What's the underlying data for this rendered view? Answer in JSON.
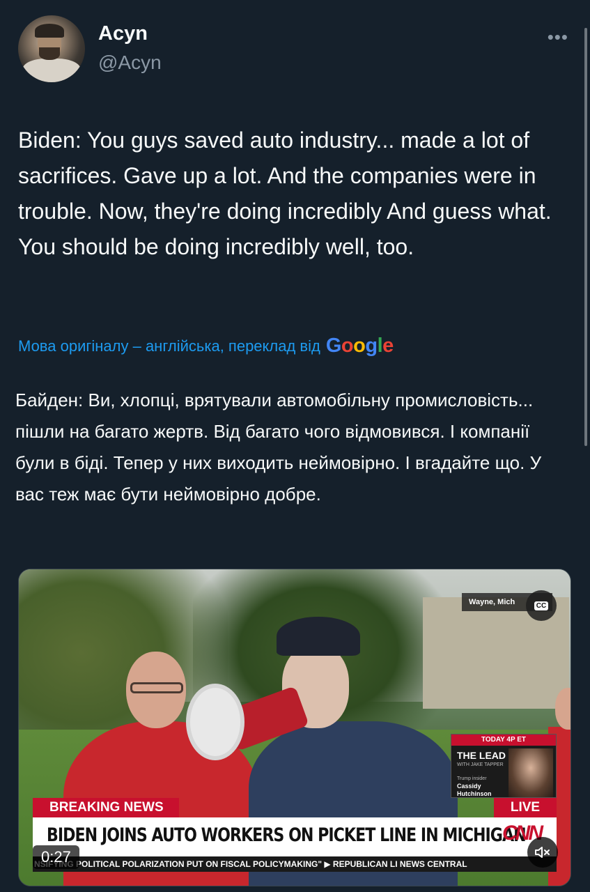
{
  "author": {
    "name": "Acyn",
    "handle": "@Acyn"
  },
  "more_icon": "more-horizontal-icon",
  "tweet": {
    "text": "Biden: You guys saved auto industry... made a lot of sacrifices. Gave up a lot. And the companies were in trouble. Now, they're doing incredibly And guess what. You should be doing incredibly well, too."
  },
  "translation": {
    "note": "Мова оригіналу – англійська, переклад від",
    "provider": "Google",
    "text": "Байден: Ви, хлопці, врятували автомобільну промисловість... пішли на багато жертв. Від багато чого відмовився. І компанії були в біді. Тепер у них виходить неймовірно. І вгадайте що. У вас теж має бути неймовірно добре."
  },
  "video": {
    "location": "Wayne, Mich",
    "cc_label": "CC",
    "promo": {
      "time": "TODAY 4P ET",
      "show": "THE LEAD",
      "host": "WITH JAKE TAPPER",
      "guest_title": "Trump insider",
      "guest_name": "Cassidy Hutchinson"
    },
    "breaking_label": "BREAKING NEWS",
    "live_label": "LIVE",
    "headline": "BIDEN JOINS AUTO WORKERS ON PICKET LINE IN MICHIGAN",
    "network": "CNN",
    "ticker": "NSIFYING POLITICAL POLARIZATION PUT ON FISCAL POLICYMAKING\"  ▶ REPUBLICAN LI NEWS CENTRAL",
    "ticker_nas": "NAS",
    "duration": "0:27",
    "mute_icon": "speaker-muted-icon"
  },
  "colors": {
    "background": "#15202b",
    "link": "#1d9bf0",
    "cnn_red": "#c8102e"
  }
}
